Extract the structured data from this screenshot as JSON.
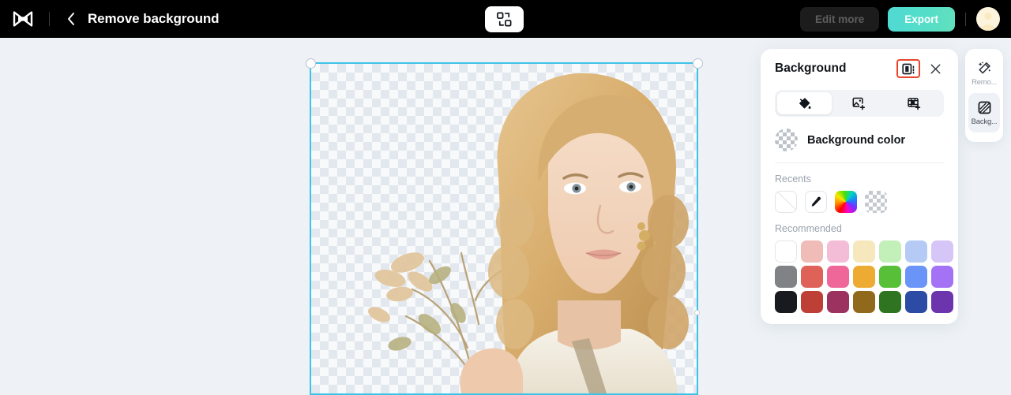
{
  "topbar": {
    "logo_icon": "capcut-logo-icon",
    "back_icon": "chevron-left-icon",
    "title": "Remove background",
    "center_tool_icon": "compare-swap-icon",
    "edit_more_label": "Edit more",
    "export_label": "Export",
    "avatar_icon": "user-avatar-icon",
    "export_color": "#54dec8",
    "bar_color": "#000000"
  },
  "canvas": {
    "background_color": "#eef2f6",
    "selection_color": "#3cc3e8",
    "transparency": "checkerboard",
    "subject_description": "woman with curly blonde hair holding dried flowers"
  },
  "panel": {
    "title": "Background",
    "collapse_icon": "collapse-panel-icon",
    "collapse_highlight_color": "#e8462a",
    "close_icon": "close-icon",
    "tabs": [
      {
        "id": "color",
        "icon": "paint-bucket-icon",
        "active": true
      },
      {
        "id": "image",
        "icon": "image-add-icon",
        "active": false
      },
      {
        "id": "video",
        "icon": "video-add-icon",
        "active": false
      }
    ],
    "background_color_row": {
      "label": "Background color",
      "swatch_icon": "transparent-checker-circle-icon"
    },
    "recents": {
      "label": "Recents",
      "items": [
        {
          "name": "none-swatch",
          "type": "none"
        },
        {
          "name": "eyedropper-swatch",
          "type": "eyedropper"
        },
        {
          "name": "color-wheel-swatch",
          "type": "wheel"
        },
        {
          "name": "transparent-swatch",
          "type": "transparent"
        }
      ]
    },
    "recommended": {
      "label": "Recommended",
      "rows": [
        [
          "#ffffff",
          "#f0bcb8",
          "#f4bdd7",
          "#f7e7bd",
          "#c3f0b9",
          "#b5cbf6",
          "#d6c5f7"
        ],
        [
          "#808285",
          "#de6257",
          "#ef6699",
          "#eeab33",
          "#57bf38",
          "#6b94f8",
          "#a472f4"
        ],
        [
          "#191a20",
          "#bd3f36",
          "#9c3260",
          "#91691c",
          "#2f7420",
          "#2c4ba4",
          "#6c35ad"
        ]
      ]
    }
  },
  "rail": {
    "items": [
      {
        "id": "remove",
        "icon": "magic-wand-icon",
        "label": "Remo...",
        "active": false
      },
      {
        "id": "background",
        "icon": "hatched-square-icon",
        "label": "Backg...",
        "active": true
      }
    ]
  }
}
